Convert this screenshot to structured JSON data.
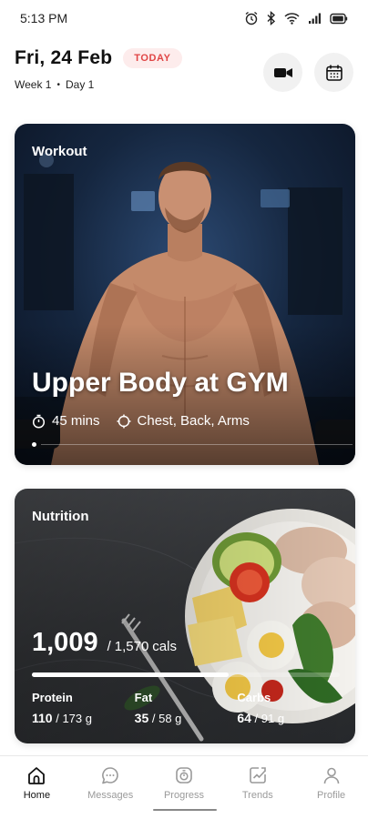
{
  "status_bar": {
    "time": "5:13 PM",
    "icons": [
      "alarm-icon",
      "bluetooth-icon",
      "wifi-icon",
      "cellular-signal-icon",
      "battery-icon"
    ]
  },
  "header": {
    "date": "Fri, 24 Feb",
    "badge": "TODAY",
    "week": "Week 1",
    "separator": "•",
    "day": "Day 1",
    "actions": [
      "video-camera-icon",
      "calendar-icon"
    ]
  },
  "workout": {
    "label": "Workout",
    "title": "Upper Body at GYM",
    "duration": "45 mins",
    "muscles": "Chest, Back, Arms",
    "image": "shirtless muscular man in gym"
  },
  "nutrition": {
    "label": "Nutrition",
    "calories": "1,009",
    "separator": "/",
    "goal": "1,570",
    "unit": "cals",
    "progress_fraction": 0.64,
    "image": "plate with chicken, avocado, tomato, cheese, egg and arugula",
    "macros": [
      {
        "name": "Protein",
        "value": "110",
        "goal": "/ 173 g"
      },
      {
        "name": "Fat",
        "value": "35",
        "goal": "/ 58 g"
      },
      {
        "name": "Carbs",
        "value": "64",
        "goal": "/ 91 g"
      }
    ]
  },
  "nav": {
    "items": [
      {
        "label": "Home",
        "icon": "home-icon",
        "active": true
      },
      {
        "label": "Messages",
        "icon": "messages-icon",
        "active": false
      },
      {
        "label": "Progress",
        "icon": "progress-icon",
        "active": false
      },
      {
        "label": "Trends",
        "icon": "trends-icon",
        "active": false
      },
      {
        "label": "Profile",
        "icon": "profile-icon",
        "active": false
      }
    ]
  },
  "colors": {
    "badge_bg": "#fdecec",
    "badge_text": "#e04545",
    "nav_active": "#111111",
    "nav_inactive": "#9a9a9a"
  }
}
